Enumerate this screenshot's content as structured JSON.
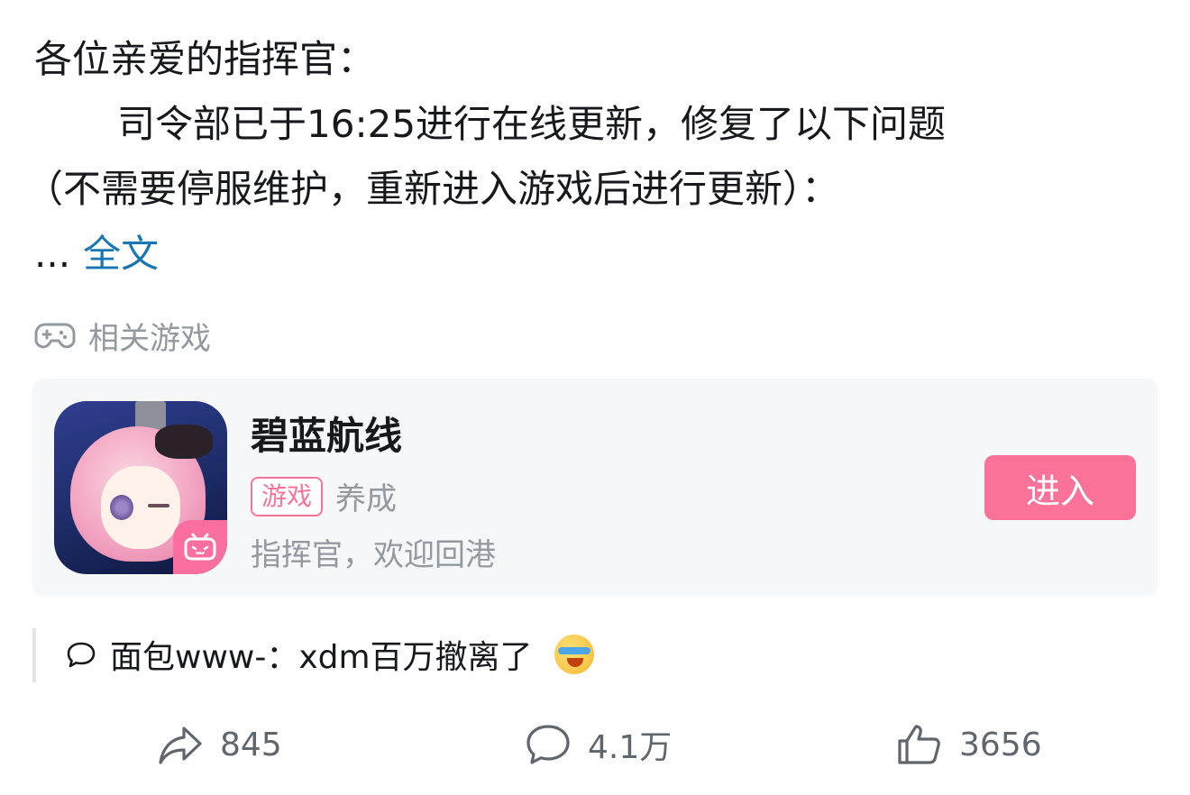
{
  "post": {
    "line1": "各位亲爱的指挥官：",
    "line2": "司令部已于16:25进行在线更新，修复了以下问题",
    "line3": "（不需要停服维护，重新进入游戏后进行更新）：",
    "ellipsis": "...",
    "full_text_link": "全文"
  },
  "related": {
    "label": "相关游戏",
    "icon": "gamepad-icon"
  },
  "game_card": {
    "name": "碧蓝航线",
    "tag": "游戏",
    "category": "养成",
    "description": "指挥官，欢迎回港",
    "enter_label": "进入",
    "accent_color": "#fb7299"
  },
  "comment": {
    "text": "面包www-：xdm百万撤离了",
    "emoji": "crying-laughing-emoji"
  },
  "actions": {
    "share_count": "845",
    "comment_count": "4.1万",
    "like_count": "3656"
  }
}
